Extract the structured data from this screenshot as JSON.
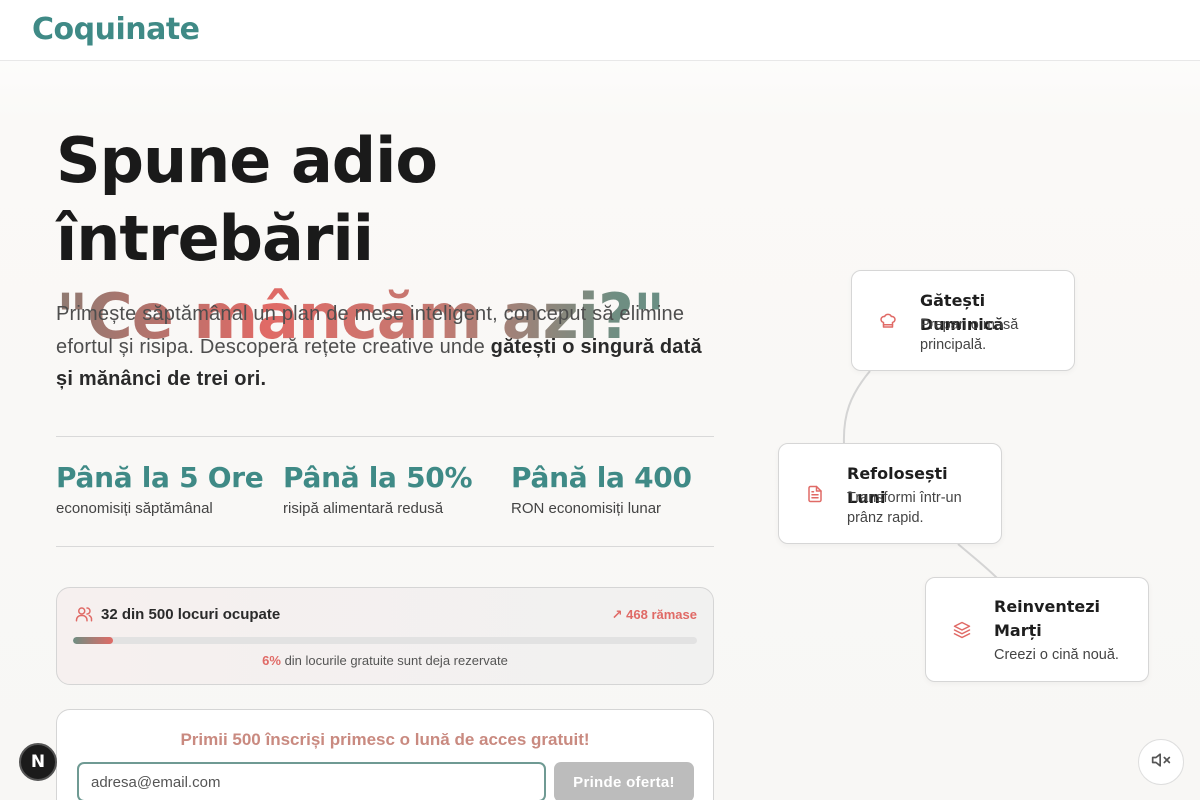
{
  "brand": {
    "name": "Coquinate"
  },
  "hero": {
    "title_line1": "Spune adio întrebării",
    "title_line2": "\"Ce mâncăm azi?\"",
    "lead_text": "Primește săptămânal un plan de mese inteligent, conceput să elimine efortul și risipa. Descoperă rețete creative unde ",
    "lead_bold": "gătești o singură dată și mănânci de trei ori."
  },
  "stats": [
    {
      "value": "Până la 5 Ore",
      "label": "economisiți săptămânal"
    },
    {
      "value": "Până la 50%",
      "label": "risipă alimentară redusă"
    },
    {
      "value": "Până la 400",
      "label": "RON economisiți lunar"
    }
  ],
  "progress": {
    "label": "32 din 500 locuri ocupate",
    "remaining": "468 rămase",
    "fill_fraction": 0.064,
    "percent_text": "6%",
    "note_text": "din locurile gratuite sunt deja rezervate"
  },
  "signup": {
    "title": "Primii 500 înscriși primesc o lună de acces gratuit!",
    "email_placeholder": "adresa@email.com",
    "button_label": "Prinde oferta!"
  },
  "steps": [
    {
      "title": "Gătești Duminică",
      "description": "Prepari o masă principală.",
      "icon": "chef-hat-icon"
    },
    {
      "title": "Refolosești Luni",
      "description": "Transformi într-un prânz rapid.",
      "icon": "document-icon"
    },
    {
      "title": "Reinventezi Marți",
      "description": "Creezi o cină nouă.",
      "icon": "layers-icon"
    }
  ],
  "floating": {
    "badge_letter": "N"
  },
  "colors": {
    "accent_teal": "#3f8a86",
    "accent_coral": "#e06a66"
  }
}
